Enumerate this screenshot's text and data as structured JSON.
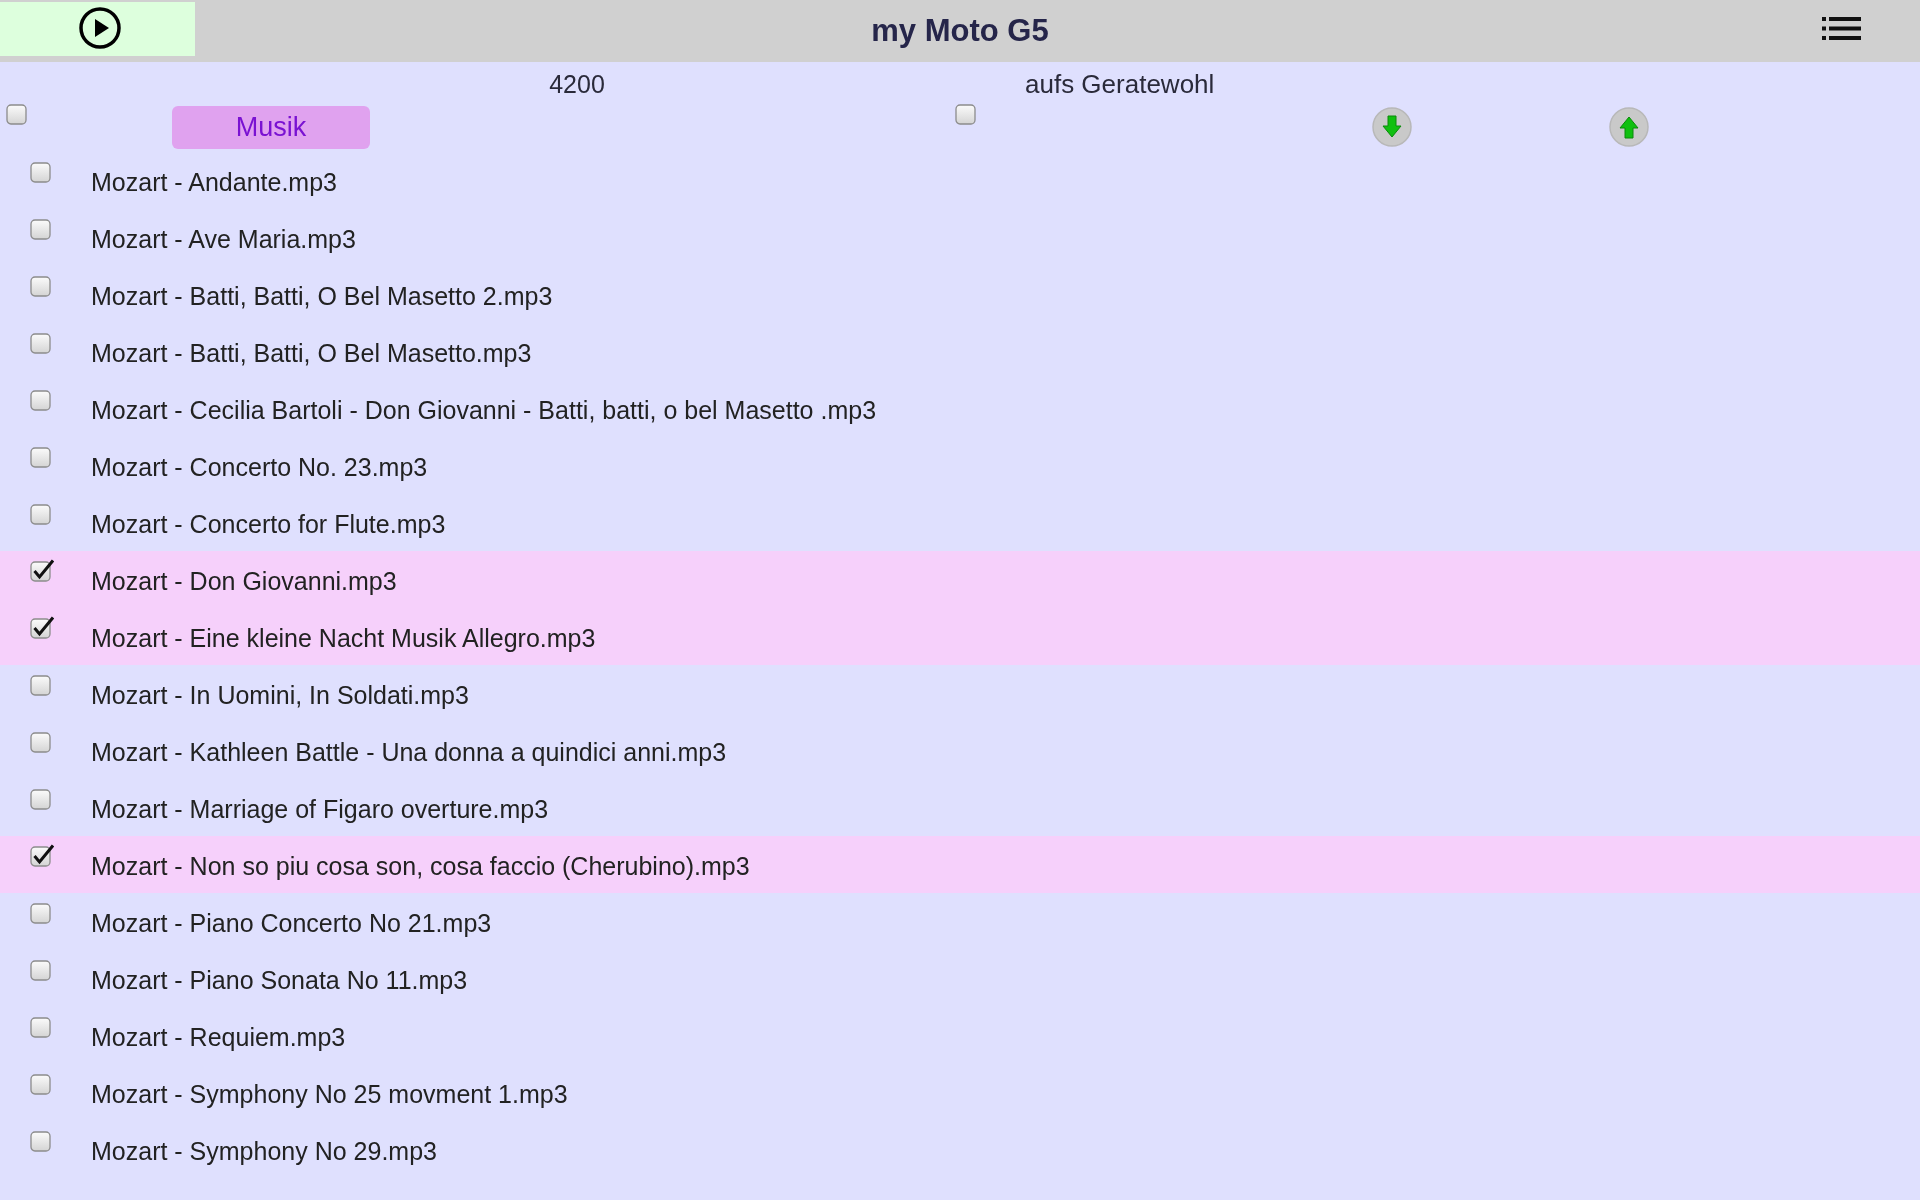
{
  "header": {
    "title": "my Moto G5"
  },
  "controls": {
    "select_all": {
      "checked": false
    },
    "category_button": {
      "label": "Musik"
    },
    "count": "4200",
    "shuffle": {
      "label": "aufs Geratewohl",
      "checked": false
    }
  },
  "files": [
    {
      "name": "Mozart - Andante.mp3",
      "checked": false
    },
    {
      "name": "Mozart - Ave Maria.mp3",
      "checked": false
    },
    {
      "name": "Mozart - Batti, Batti, O Bel Masetto 2.mp3",
      "checked": false
    },
    {
      "name": "Mozart - Batti, Batti, O Bel Masetto.mp3",
      "checked": false
    },
    {
      "name": "Mozart - Cecilia Bartoli - Don Giovanni - Batti, batti, o bel Masetto .mp3",
      "checked": false
    },
    {
      "name": "Mozart - Concerto No. 23.mp3",
      "checked": false
    },
    {
      "name": "Mozart - Concerto for Flute.mp3",
      "checked": false
    },
    {
      "name": "Mozart - Don Giovanni.mp3",
      "checked": true
    },
    {
      "name": "Mozart - Eine kleine Nacht Musik Allegro.mp3",
      "checked": true
    },
    {
      "name": "Mozart - In Uomini, In Soldati.mp3",
      "checked": false
    },
    {
      "name": "Mozart - Kathleen Battle - Una donna a quindici anni.mp3",
      "checked": false
    },
    {
      "name": "Mozart - Marriage of Figaro overture.mp3",
      "checked": false
    },
    {
      "name": "Mozart - Non so piu cosa son, cosa faccio (Cherubino).mp3",
      "checked": true
    },
    {
      "name": "Mozart - Piano Concerto No 21.mp3",
      "checked": false
    },
    {
      "name": "Mozart - Piano Sonata No 11.mp3",
      "checked": false
    },
    {
      "name": "Mozart - Requiem.mp3",
      "checked": false
    },
    {
      "name": "Mozart - Symphony No 25 movment 1.mp3",
      "checked": false
    },
    {
      "name": "Mozart - Symphony No 29.mp3",
      "checked": false
    }
  ]
}
